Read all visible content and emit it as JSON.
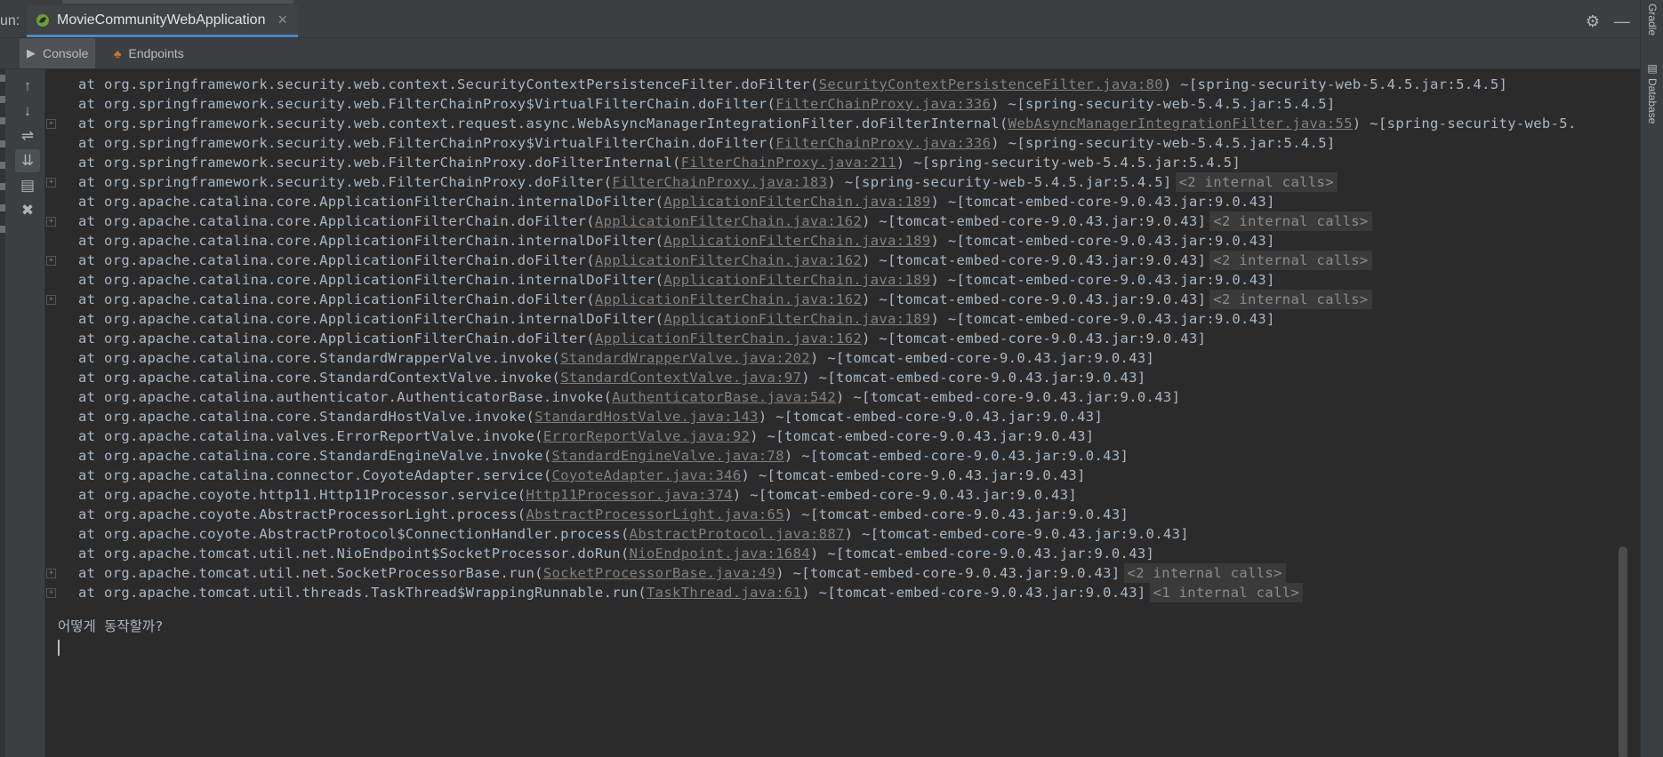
{
  "run_panel": {
    "label": "un:",
    "tab_title": "MovieCommunityWebApplication",
    "close_glyph": "×"
  },
  "title_actions": {
    "settings_icon": "⚙",
    "minimize_icon": "—"
  },
  "tabs": [
    {
      "label": "Console",
      "icon": "console-icon",
      "glyph": "▶",
      "icon_color": "#afb1b3"
    },
    {
      "label": "Endpoints",
      "icon": "endpoints-icon",
      "glyph": "♣",
      "icon_color": "#c57633"
    }
  ],
  "toolbar": [
    {
      "name": "up-arrow-icon",
      "glyph": "↑"
    },
    {
      "name": "down-arrow-icon",
      "glyph": "↓"
    },
    {
      "name": "soft-wrap-icon",
      "glyph": "⇌"
    },
    {
      "name": "scroll-to-end-icon",
      "glyph": "⇊"
    },
    {
      "name": "print-icon",
      "glyph": "▤"
    },
    {
      "name": "trash-icon",
      "glyph": "✖"
    }
  ],
  "right_strip": {
    "gradle": "Gradle",
    "database": "Database"
  },
  "log_lines": [
    {
      "pre": "at org.springframework.security.web.context.SecurityContextPersistenceFilter.doFilter(",
      "link": "SecurityContextPersistenceFilter.java:80",
      "post": ") ~[spring-security-web-5.4.5.jar:5.4.5]",
      "calls": "",
      "fold": false
    },
    {
      "pre": "at org.springframework.security.web.FilterChainProxy$VirtualFilterChain.doFilter(",
      "link": "FilterChainProxy.java:336",
      "post": ") ~[spring-security-web-5.4.5.jar:5.4.5]",
      "calls": "",
      "fold": false
    },
    {
      "pre": "at org.springframework.security.web.context.request.async.WebAsyncManagerIntegrationFilter.doFilterInternal(",
      "link": "WebAsyncManagerIntegrationFilter.java:55",
      "post": ") ~[spring-security-web-5.",
      "calls": "",
      "fold": true
    },
    {
      "pre": "at org.springframework.security.web.FilterChainProxy$VirtualFilterChain.doFilter(",
      "link": "FilterChainProxy.java:336",
      "post": ") ~[spring-security-web-5.4.5.jar:5.4.5]",
      "calls": "",
      "fold": false
    },
    {
      "pre": "at org.springframework.security.web.FilterChainProxy.doFilterInternal(",
      "link": "FilterChainProxy.java:211",
      "post": ") ~[spring-security-web-5.4.5.jar:5.4.5]",
      "calls": "",
      "fold": false
    },
    {
      "pre": "at org.springframework.security.web.FilterChainProxy.doFilter(",
      "link": "FilterChainProxy.java:183",
      "post": ") ~[spring-security-web-5.4.5.jar:5.4.5]",
      "calls": "<2 internal calls>",
      "fold": true
    },
    {
      "pre": "at org.apache.catalina.core.ApplicationFilterChain.internalDoFilter(",
      "link": "ApplicationFilterChain.java:189",
      "post": ") ~[tomcat-embed-core-9.0.43.jar:9.0.43]",
      "calls": "",
      "fold": false
    },
    {
      "pre": "at org.apache.catalina.core.ApplicationFilterChain.doFilter(",
      "link": "ApplicationFilterChain.java:162",
      "post": ") ~[tomcat-embed-core-9.0.43.jar:9.0.43]",
      "calls": "<2 internal calls>",
      "fold": true
    },
    {
      "pre": "at org.apache.catalina.core.ApplicationFilterChain.internalDoFilter(",
      "link": "ApplicationFilterChain.java:189",
      "post": ") ~[tomcat-embed-core-9.0.43.jar:9.0.43]",
      "calls": "",
      "fold": false
    },
    {
      "pre": "at org.apache.catalina.core.ApplicationFilterChain.doFilter(",
      "link": "ApplicationFilterChain.java:162",
      "post": ") ~[tomcat-embed-core-9.0.43.jar:9.0.43]",
      "calls": "<2 internal calls>",
      "fold": true
    },
    {
      "pre": "at org.apache.catalina.core.ApplicationFilterChain.internalDoFilter(",
      "link": "ApplicationFilterChain.java:189",
      "post": ") ~[tomcat-embed-core-9.0.43.jar:9.0.43]",
      "calls": "",
      "fold": false
    },
    {
      "pre": "at org.apache.catalina.core.ApplicationFilterChain.doFilter(",
      "link": "ApplicationFilterChain.java:162",
      "post": ") ~[tomcat-embed-core-9.0.43.jar:9.0.43]",
      "calls": "<2 internal calls>",
      "fold": true
    },
    {
      "pre": "at org.apache.catalina.core.ApplicationFilterChain.internalDoFilter(",
      "link": "ApplicationFilterChain.java:189",
      "post": ") ~[tomcat-embed-core-9.0.43.jar:9.0.43]",
      "calls": "",
      "fold": false
    },
    {
      "pre": "at org.apache.catalina.core.ApplicationFilterChain.doFilter(",
      "link": "ApplicationFilterChain.java:162",
      "post": ") ~[tomcat-embed-core-9.0.43.jar:9.0.43]",
      "calls": "",
      "fold": false
    },
    {
      "pre": "at org.apache.catalina.core.StandardWrapperValve.invoke(",
      "link": "StandardWrapperValve.java:202",
      "post": ") ~[tomcat-embed-core-9.0.43.jar:9.0.43]",
      "calls": "",
      "fold": false
    },
    {
      "pre": "at org.apache.catalina.core.StandardContextValve.invoke(",
      "link": "StandardContextValve.java:97",
      "post": ") ~[tomcat-embed-core-9.0.43.jar:9.0.43]",
      "calls": "",
      "fold": false
    },
    {
      "pre": "at org.apache.catalina.authenticator.AuthenticatorBase.invoke(",
      "link": "AuthenticatorBase.java:542",
      "post": ") ~[tomcat-embed-core-9.0.43.jar:9.0.43]",
      "calls": "",
      "fold": false
    },
    {
      "pre": "at org.apache.catalina.core.StandardHostValve.invoke(",
      "link": "StandardHostValve.java:143",
      "post": ") ~[tomcat-embed-core-9.0.43.jar:9.0.43]",
      "calls": "",
      "fold": false
    },
    {
      "pre": "at org.apache.catalina.valves.ErrorReportValve.invoke(",
      "link": "ErrorReportValve.java:92",
      "post": ") ~[tomcat-embed-core-9.0.43.jar:9.0.43]",
      "calls": "",
      "fold": false
    },
    {
      "pre": "at org.apache.catalina.core.StandardEngineValve.invoke(",
      "link": "StandardEngineValve.java:78",
      "post": ") ~[tomcat-embed-core-9.0.43.jar:9.0.43]",
      "calls": "",
      "fold": false
    },
    {
      "pre": "at org.apache.catalina.connector.CoyoteAdapter.service(",
      "link": "CoyoteAdapter.java:346",
      "post": ") ~[tomcat-embed-core-9.0.43.jar:9.0.43]",
      "calls": "",
      "fold": false
    },
    {
      "pre": "at org.apache.coyote.http11.Http11Processor.service(",
      "link": "Http11Processor.java:374",
      "post": ") ~[tomcat-embed-core-9.0.43.jar:9.0.43]",
      "calls": "",
      "fold": false
    },
    {
      "pre": "at org.apache.coyote.AbstractProcessorLight.process(",
      "link": "AbstractProcessorLight.java:65",
      "post": ") ~[tomcat-embed-core-9.0.43.jar:9.0.43]",
      "calls": "",
      "fold": false
    },
    {
      "pre": "at org.apache.coyote.AbstractProtocol$ConnectionHandler.process(",
      "link": "AbstractProtocol.java:887",
      "post": ") ~[tomcat-embed-core-9.0.43.jar:9.0.43]",
      "calls": "",
      "fold": false
    },
    {
      "pre": "at org.apache.tomcat.util.net.NioEndpoint$SocketProcessor.doRun(",
      "link": "NioEndpoint.java:1684",
      "post": ") ~[tomcat-embed-core-9.0.43.jar:9.0.43]",
      "calls": "",
      "fold": false
    },
    {
      "pre": "at org.apache.tomcat.util.net.SocketProcessorBase.run(",
      "link": "SocketProcessorBase.java:49",
      "post": ") ~[tomcat-embed-core-9.0.43.jar:9.0.43]",
      "calls": "<2 internal calls>",
      "fold": true
    },
    {
      "pre": "at org.apache.tomcat.util.threads.TaskThread$WrappingRunnable.run(",
      "link": "TaskThread.java:61",
      "post": ") ~[tomcat-embed-core-9.0.43.jar:9.0.43]",
      "calls": "<1 internal call>",
      "fold": true
    }
  ],
  "user_input": "어떻게 동작할까?",
  "colors": {
    "background": "#2b2b2b",
    "panel": "#3c3f41",
    "text": "#a9b7c6",
    "link": "#808080",
    "tab_underline": "#4a88c7",
    "spring_icon": "#6a9f3a"
  }
}
